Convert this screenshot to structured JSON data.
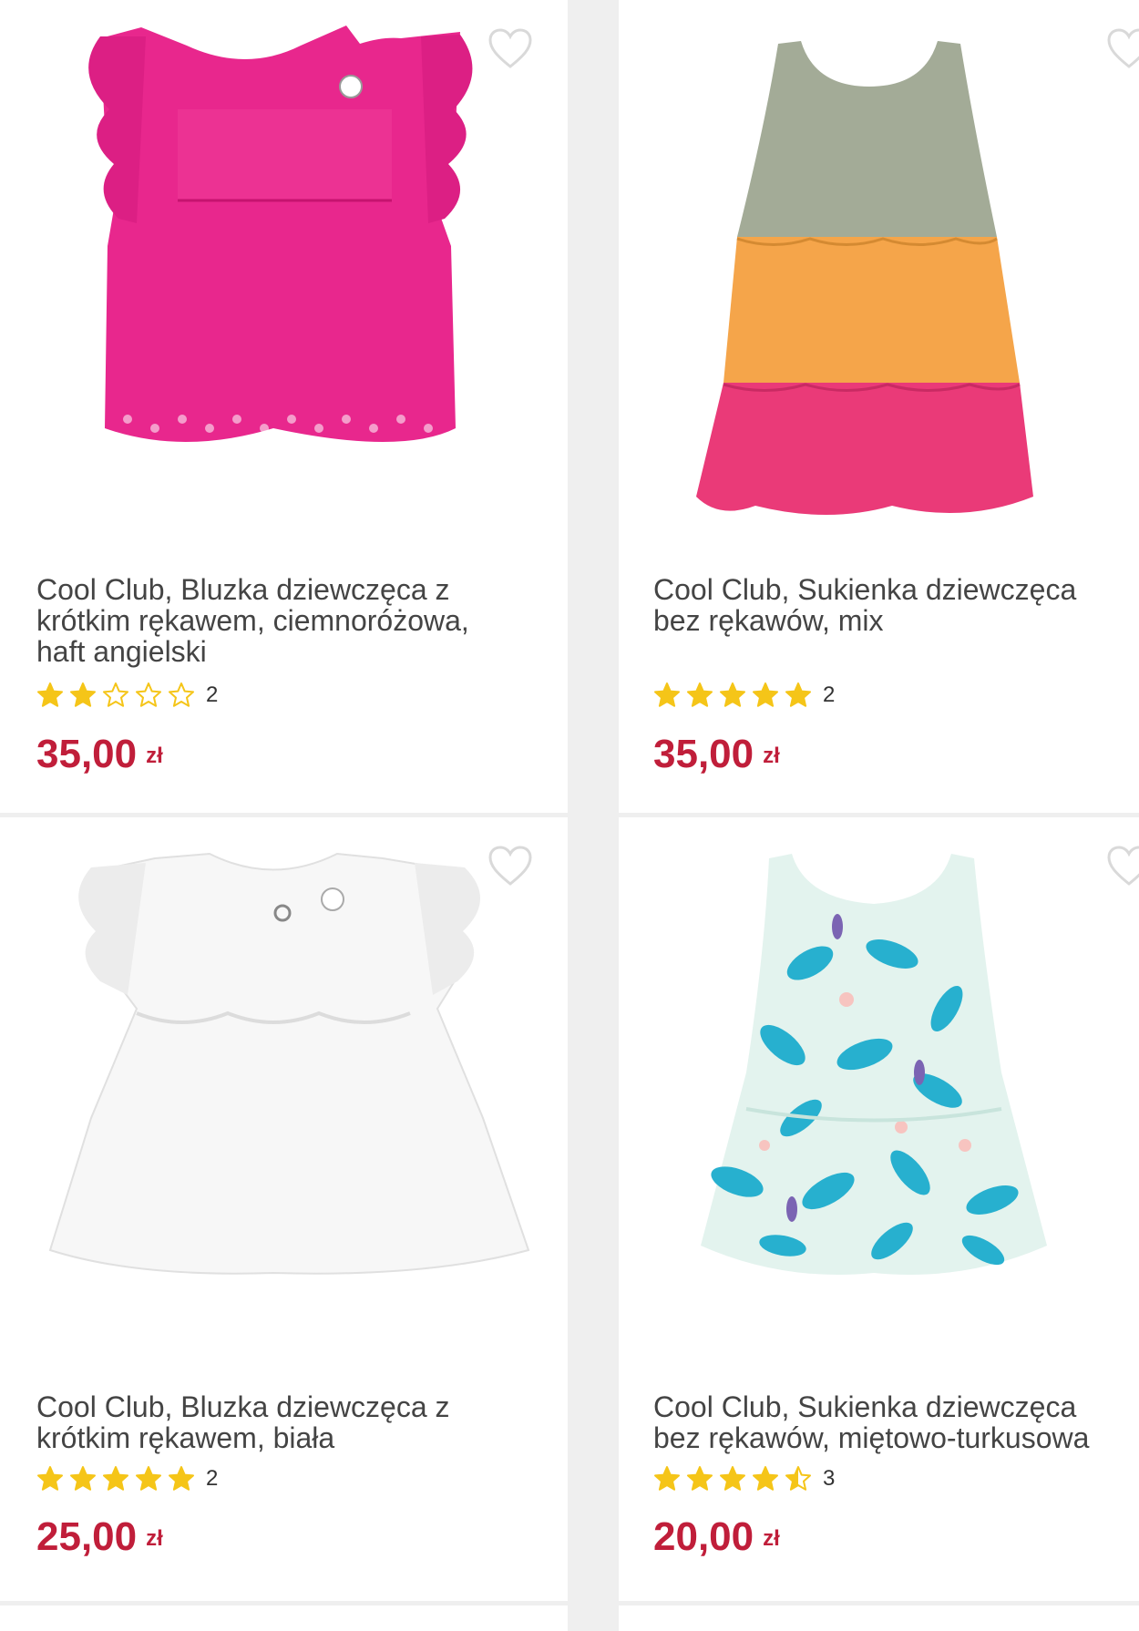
{
  "products": [
    {
      "title_lines": [
        "Cool Club, Bluzka dziewczęca z",
        "krótkim rękawem, ciemnoróżowa,",
        "haft angielski"
      ],
      "rating_stars": 2,
      "rating_count": "2",
      "price_value": "35,00",
      "price_currency": "zł",
      "image_icon": "pink-blouse-image",
      "color": "#ea2a8f"
    },
    {
      "title_lines": [
        "Cool Club, Sukienka dziewczęca",
        "bez rękawów, mix"
      ],
      "rating_stars": 5,
      "rating_count": "2",
      "price_value": "35,00",
      "price_currency": "zł",
      "image_icon": "tiered-dress-image",
      "color": "#f5a44a"
    },
    {
      "title_lines": [
        "Cool Club, Bluzka dziewczęca z",
        "krótkim rękawem, biała"
      ],
      "rating_stars": 5,
      "rating_count": "2",
      "price_value": "25,00",
      "price_currency": "zł",
      "image_icon": "white-blouse-image",
      "color": "#f6f6f6"
    },
    {
      "title_lines": [
        "Cool Club, Sukienka dziewczęca",
        "bez rękawów, miętowo-turkusowa"
      ],
      "rating_stars": 4.5,
      "rating_count": "3",
      "price_value": "20,00",
      "price_currency": "zł",
      "image_icon": "mint-leaf-dress-image",
      "color": "#2fb3d0"
    }
  ],
  "colors": {
    "price": "#c01e3a",
    "star": "#f5c518",
    "heart_outline": "#d9d9d9",
    "title": "#444444",
    "background": "#efefef"
  },
  "icons": {
    "wishlist": "heart-outline-icon",
    "rating": "star-icon"
  }
}
